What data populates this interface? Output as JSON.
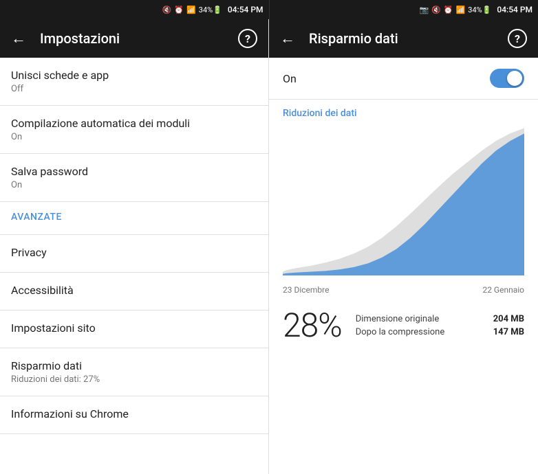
{
  "statusBar": {
    "leftIcons": "🔇 ⏰ 📶 34% 🔋",
    "time": "04:54 PM",
    "rightIcons": "📷 🔇 ⏰ 📶 34% 🔋",
    "time2": "04:54 PM"
  },
  "leftPanel": {
    "header": {
      "backIcon": "←",
      "title": "Impostazioni",
      "helpIcon": "?"
    },
    "items": [
      {
        "title": "Unisci schede e app",
        "subtitle": "Off"
      },
      {
        "title": "Compilazione automatica dei moduli",
        "subtitle": "On"
      },
      {
        "title": "Salva password",
        "subtitle": "On"
      },
      {
        "title": "Avanzate",
        "subtitle": "",
        "accent": true
      },
      {
        "title": "Privacy",
        "subtitle": ""
      },
      {
        "title": "Accessibilità",
        "subtitle": ""
      },
      {
        "title": "Impostazioni sito",
        "subtitle": ""
      },
      {
        "title": "Risparmio dati",
        "subtitle": "Riduzioni dei dati: 27%"
      },
      {
        "title": "Informazioni su Chrome",
        "subtitle": ""
      }
    ]
  },
  "rightPanel": {
    "header": {
      "backIcon": "←",
      "title": "Risparmio dati",
      "helpIcon": "?"
    },
    "toggleLabel": "On",
    "sectionTitle": "Riduzioni dei dati",
    "chartStartLabel": "23 Dicembre",
    "chartEndLabel": "22 Gennaio",
    "percent": "28%",
    "stat1Label": "Dimensione originale",
    "stat1Value": "204 MB",
    "stat2Label": "Dopo la compressione",
    "stat2Value": "147 MB"
  }
}
